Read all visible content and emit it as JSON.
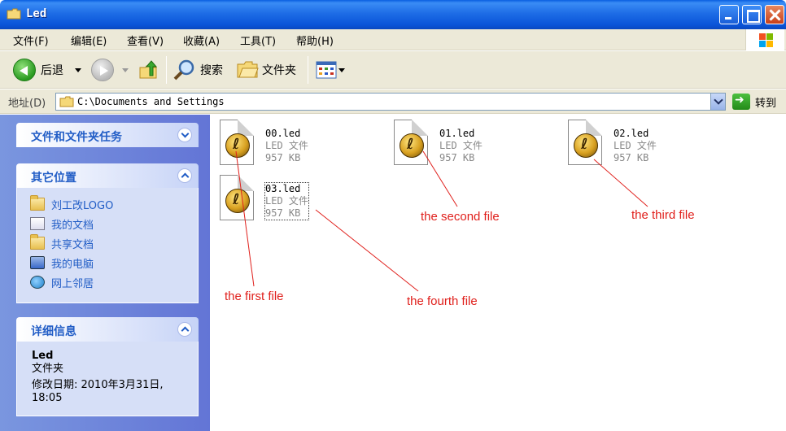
{
  "window": {
    "title": "Led"
  },
  "menu": {
    "items": [
      "文件(F)",
      "编辑(E)",
      "查看(V)",
      "收藏(A)",
      "工具(T)",
      "帮助(H)"
    ]
  },
  "toolbar": {
    "back_label": "后退",
    "search_label": "搜索",
    "folders_label": "文件夹"
  },
  "address": {
    "label": "地址(D)",
    "value": "C:\\Documents and Settings",
    "go_label": "转到"
  },
  "taskpane": {
    "tasks_title": "文件和文件夹任务",
    "other_title": "其它位置",
    "other_items": [
      {
        "label": "刘工改LOGO",
        "icon": "folder-icon"
      },
      {
        "label": "我的文档",
        "icon": "documents-icon"
      },
      {
        "label": "共享文档",
        "icon": "folder-icon"
      },
      {
        "label": "我的电脑",
        "icon": "computer-icon"
      },
      {
        "label": "网上邻居",
        "icon": "network-icon"
      }
    ],
    "details_title": "详细信息",
    "details_name": "Led",
    "details_type": "文件夹",
    "details_modified_line1": "修改日期: 2010年3月31日,",
    "details_modified_line2": "18:05"
  },
  "files": [
    {
      "name": "00.led",
      "type": "LED 文件",
      "size": "957 KB"
    },
    {
      "name": "01.led",
      "type": "LED 文件",
      "size": "957 KB"
    },
    {
      "name": "02.led",
      "type": "LED 文件",
      "size": "957 KB"
    },
    {
      "name": "03.led",
      "type": "LED 文件",
      "size": "957 KB"
    }
  ],
  "annotations": {
    "first": "the first file",
    "second": "the second file",
    "third": "the third file",
    "fourth": "the fourth file",
    "color": "#e0201c"
  }
}
